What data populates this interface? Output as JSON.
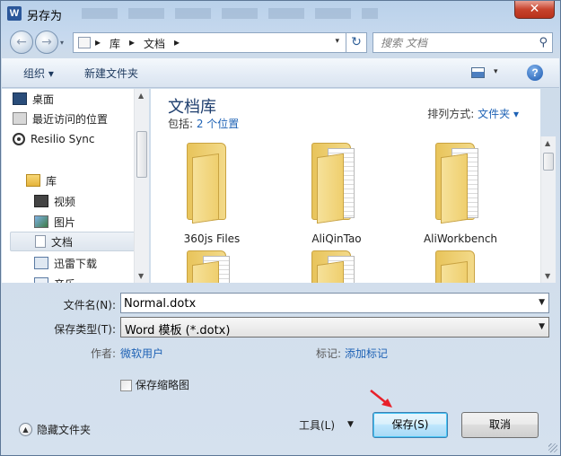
{
  "window": {
    "title": "另存为",
    "app_icon": "W",
    "close_symbol": "✕"
  },
  "nav": {
    "back_icon": "←",
    "forward_icon": "→",
    "dropdown_icon": "▾",
    "breadcrumb": [
      "库",
      "文档"
    ],
    "separator": "▸",
    "refresh_icon": "↻",
    "search_placeholder": "搜索 文档",
    "search_icon": "⚲"
  },
  "toolbar": {
    "organize": "组织 ▾",
    "new_folder": "新建文件夹",
    "view_dropdown": "▾",
    "help": "?"
  },
  "sidebar": {
    "items": [
      {
        "label": "桌面"
      },
      {
        "label": "最近访问的位置"
      },
      {
        "label": "Resilio Sync"
      },
      {
        "label": "库"
      },
      {
        "label": "视频"
      },
      {
        "label": "图片"
      },
      {
        "label": "文档"
      },
      {
        "label": "迅雷下载"
      },
      {
        "label": "音乐"
      }
    ]
  },
  "library": {
    "title": "文档库",
    "includes_label": "包括: ",
    "includes_link": "2 个位置",
    "arrange_label": "排列方式: ",
    "arrange_value": "文件夹 ▾"
  },
  "folders": [
    {
      "name": "360js Files"
    },
    {
      "name": "AliQinTao"
    },
    {
      "name": "AliWorkbench"
    },
    {
      "name": ""
    },
    {
      "name": ""
    },
    {
      "name": ""
    }
  ],
  "form": {
    "filename_label": "文件名(N):",
    "filename_value": "Normal.dotx",
    "filetype_label": "保存类型(T):",
    "filetype_value": "Word 模板 (*.dotx)",
    "author_label": "作者:",
    "author_value": "微软用户",
    "tags_label": "标记:",
    "tags_value": "添加标记",
    "thumbnail_label": "保存缩略图"
  },
  "footer": {
    "hide_folders": "隐藏文件夹",
    "hide_icon": "▲",
    "tools": "工具(L)",
    "tools_arrow": "▼",
    "save": "保存(S)",
    "cancel": "取消"
  }
}
